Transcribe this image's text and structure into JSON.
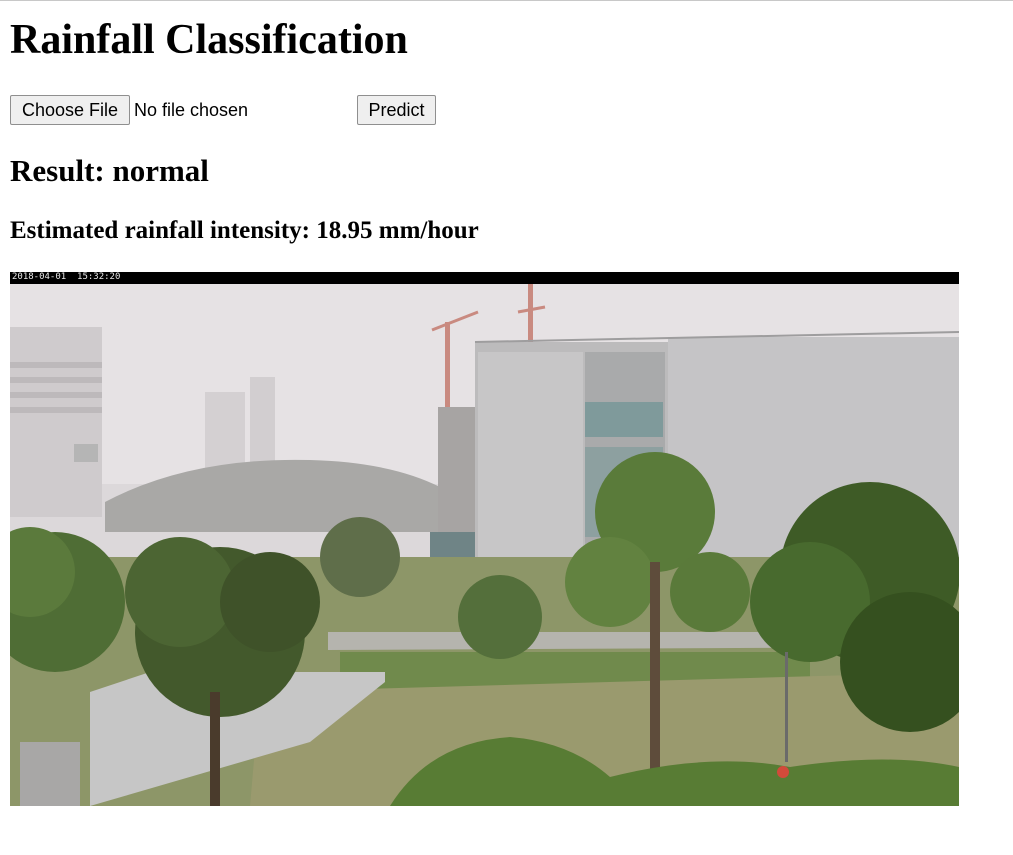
{
  "page": {
    "title": "Rainfall Classification",
    "upload": {
      "choose_label": "Choose File",
      "status_text": "No file chosen",
      "predict_label": "Predict"
    },
    "result_heading": "Result: normal",
    "intensity_text": "Estimated rainfall intensity: 18.95 mm/hour",
    "image": {
      "timestamp": "2018-04-01  15:32:20"
    }
  }
}
